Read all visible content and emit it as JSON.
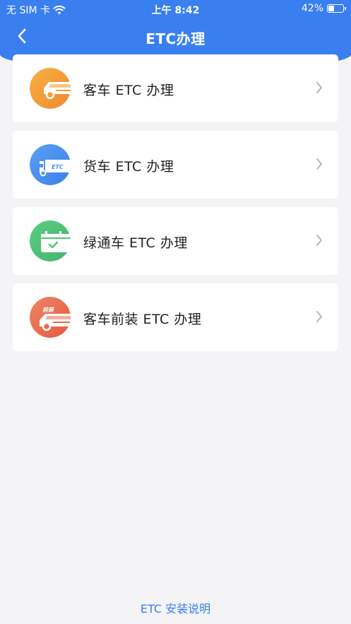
{
  "status_bar": {
    "carrier": "无 SIM 卡",
    "time": "上午 8:42",
    "battery": "42%",
    "battery_level": 0.42
  },
  "nav": {
    "title": "ETC办理",
    "back_icon": "chevron-left-icon"
  },
  "colors": {
    "brand_blue": "#3a7ff0",
    "orange": "#f39a35",
    "blue": "#4f93f4",
    "green": "#52c27a",
    "red": "#ea6a4f"
  },
  "items": [
    {
      "label": "客车 ETC 办理",
      "icon": "car-icon"
    },
    {
      "label": "货车 ETC 办理",
      "icon": "truck-icon",
      "icon_text": "ETC"
    },
    {
      "label": "绿通车 ETC 办理",
      "icon": "calendar-check-icon"
    },
    {
      "label": "客车前装 ETC 办理",
      "icon": "car-front-install-icon",
      "icon_text": "前装"
    }
  ],
  "footer": {
    "link": "ETC 安装说明"
  }
}
